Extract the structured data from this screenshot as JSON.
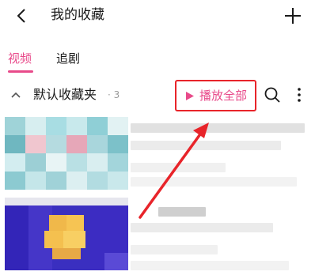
{
  "header": {
    "title": "我的收藏",
    "back_icon": "chevron-left-icon",
    "add_icon": "plus-icon"
  },
  "tabs": [
    {
      "label": "视频",
      "active": true
    },
    {
      "label": "追剧",
      "active": false
    }
  ],
  "folder": {
    "name": "默认收藏夹",
    "count": "· 3",
    "collapse_icon": "chevron-up-icon",
    "play_all_label": "播放全部",
    "play_icon": "play-triangle-icon",
    "search_icon": "search-icon",
    "more_icon": "more-vertical-icon"
  },
  "colors": {
    "accent_pink": "#e84a8a",
    "highlight_red": "#e8242a",
    "text_dark": "#1a1a1a",
    "text_muted": "#9a9a9a"
  }
}
